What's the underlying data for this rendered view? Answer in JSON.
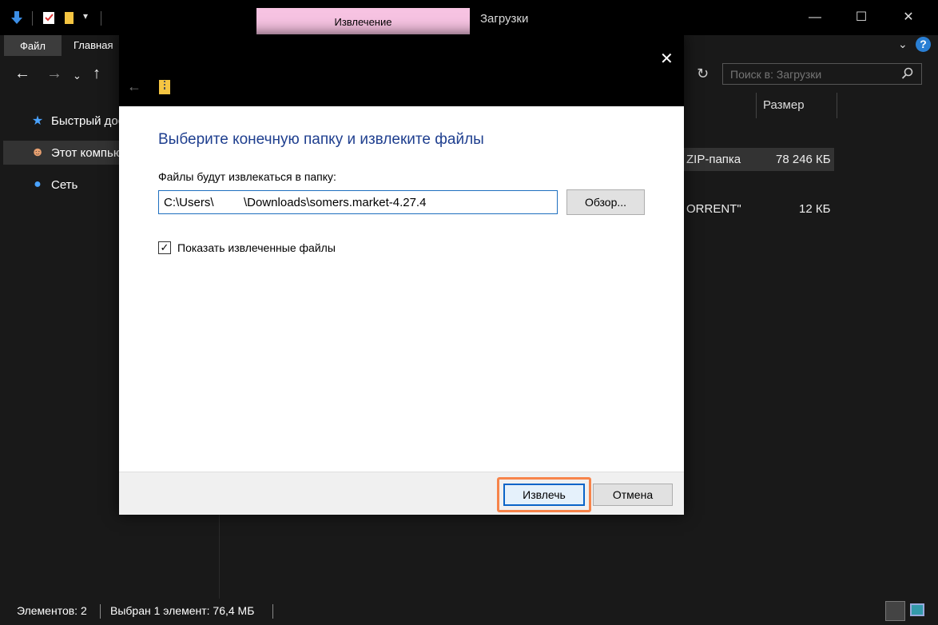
{
  "titlebar": {
    "context_tab": "Извлечение",
    "title": "Загрузки",
    "quick_icons": [
      "download-arrow-icon",
      "properties-icon",
      "folder-icon",
      "customize-dropdown-icon"
    ],
    "window_buttons": {
      "minimize": "—",
      "maximize": "☐",
      "close": "✕"
    }
  },
  "ribbon": {
    "file_tab": "Файл",
    "home_tab": "Главная"
  },
  "nav": {
    "search_placeholder": "Поиск в: Загрузки",
    "items": [
      {
        "label": "Быстрый дос",
        "icon": "star-icon",
        "glyph": "★",
        "color": "#4aa3ff"
      },
      {
        "label": "Этот компью",
        "icon": "this-pc-icon",
        "glyph": "🐱",
        "color": "#e8a070"
      },
      {
        "label": "Сеть",
        "icon": "network-icon",
        "glyph": "●",
        "color": "#4aa3ff"
      }
    ]
  },
  "files": {
    "size_header": "Размер",
    "rows": [
      {
        "type": "ZIP-папка",
        "size": "78 246 КБ"
      },
      {
        "type": "ORRENT\"",
        "size": "12 КБ"
      }
    ]
  },
  "statusbar": {
    "count": "Элементов: 2",
    "selection": "Выбран 1 элемент: 76,4 МБ"
  },
  "dialog": {
    "heading": "Выберите конечную папку и извлеките файлы",
    "label": "Файлы будут извлекаться в папку:",
    "path_value": "C:\\Users\\         \\Downloads\\somers.market-4.27.4",
    "browse": "Обзор...",
    "show_files_label": "Показать извлеченные файлы",
    "show_files_checked": "✓",
    "extract": "Извлечь",
    "cancel": "Отмена",
    "close": "✕",
    "back": "←"
  },
  "colors": {
    "accent": "#0a64c8",
    "highlight": "#f7844a",
    "context_tab": "#f7c3e2"
  }
}
